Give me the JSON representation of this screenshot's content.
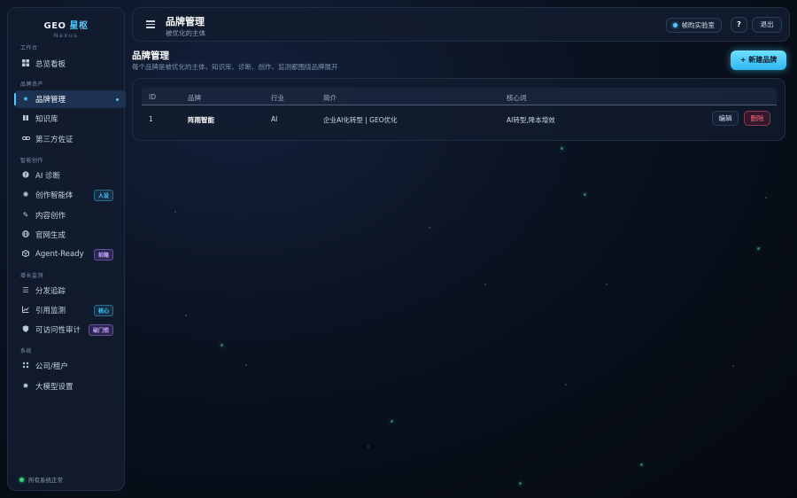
{
  "app": {
    "name_prefix": "GEO",
    "name_accent": "星枢",
    "subtitle": "Nexus"
  },
  "sidebar": {
    "sections": [
      {
        "label": "工作台"
      },
      {
        "label": "品牌资产"
      },
      {
        "label": "智能创作"
      },
      {
        "label": "增长监测"
      },
      {
        "label": "系统"
      }
    ],
    "items": [
      {
        "label": "总览看板",
        "icon": "dashboard-icon"
      },
      {
        "label": "品牌管理",
        "icon": "star-icon",
        "active": true
      },
      {
        "label": "知识库",
        "icon": "book-icon"
      },
      {
        "label": "第三方佐证",
        "icon": "link-icon"
      },
      {
        "label": "AI 诊断",
        "icon": "alert-circle-icon"
      },
      {
        "label": "创作智能体",
        "icon": "sparkle-icon",
        "badge": "人设"
      },
      {
        "label": "内容创作",
        "icon": "pencil-icon"
      },
      {
        "label": "官网生成",
        "icon": "globe-icon"
      },
      {
        "label": "Agent-Ready",
        "icon": "cube-icon",
        "badge": "前瞻"
      },
      {
        "label": "分发追踪",
        "icon": "list-icon"
      },
      {
        "label": "引用监测",
        "icon": "chart-line-icon",
        "badge": "核心"
      },
      {
        "label": "可访问性审计",
        "icon": "shield-icon",
        "badge": "破门慌"
      },
      {
        "label": "公司/租户",
        "icon": "grid-icon"
      },
      {
        "label": "大模型设置",
        "icon": "gear-icon"
      }
    ],
    "status": "所有系统正常",
    "colors": {
      "accent": "#4ec8ff",
      "status_ok": "#3bd17a"
    }
  },
  "header": {
    "title": "品牌管理",
    "subtitle": "被优化的主体",
    "lab_label": "帧昀实验室",
    "help_label": "?",
    "logout_label": "退出"
  },
  "main": {
    "title": "品牌管理",
    "subtitle": "每个品牌是被优化的主体，知识库、诊断、创作、监测都围绕品牌展开",
    "new_button": "+ 新建品牌",
    "table": {
      "columns": [
        "ID",
        "品牌",
        "行业",
        "简介",
        "核心词"
      ],
      "rows": [
        {
          "id": "1",
          "brand": "阵雨智能",
          "industry": "AI",
          "intro": "企业AI化转型 | GEO优化",
          "keywords": "AI转型,降本增效",
          "edit": "编辑",
          "delete": "删除"
        }
      ]
    }
  }
}
